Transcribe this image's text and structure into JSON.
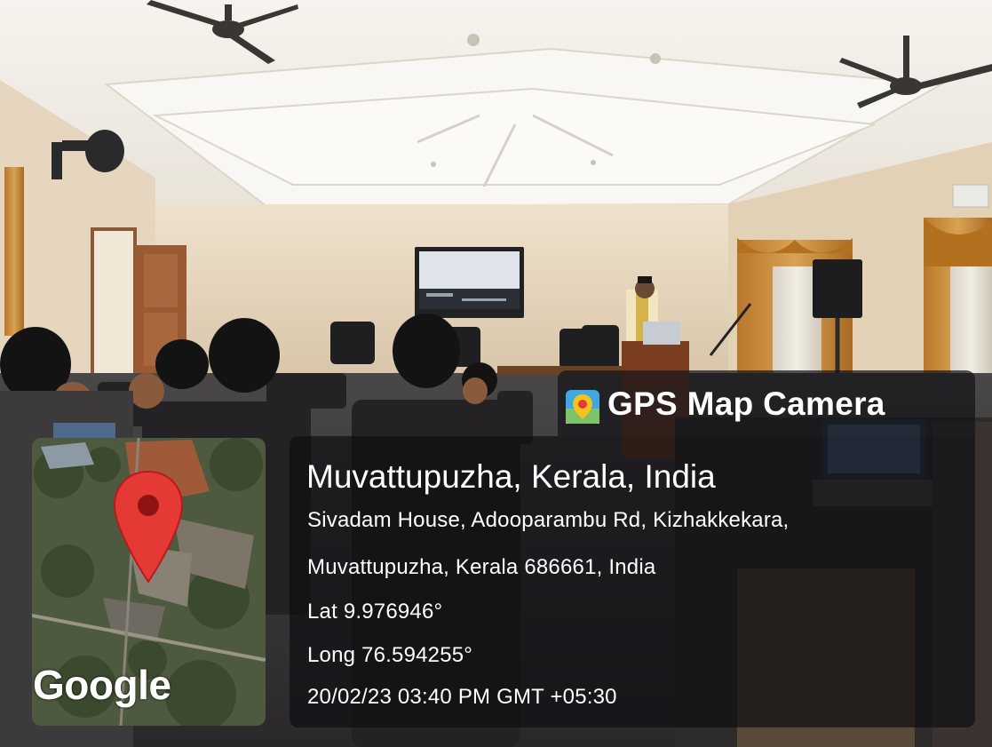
{
  "app": {
    "badge_label": "GPS Map Camera",
    "icon": "map-pin-app-icon"
  },
  "location": {
    "title": "Muvattupuzha, Kerala, India",
    "address_line1": "Sivadam House, Adooparambu Rd, Kizhakkekara,",
    "address_line2": "Muvattupuzha, Kerala 686661, India",
    "latitude": "Lat 9.976946°",
    "longitude": "Long 76.594255°",
    "datetime": "20/02/23 03:40 PM GMT +05:30"
  },
  "map": {
    "attribution": "Google",
    "pin_icon": "location-pin-icon",
    "pin_color": "#e53935"
  },
  "colors": {
    "overlay": "#141418",
    "wall": "#e9d6bd",
    "ceiling": "#f3efe9",
    "curtain": "#c88a3a"
  }
}
